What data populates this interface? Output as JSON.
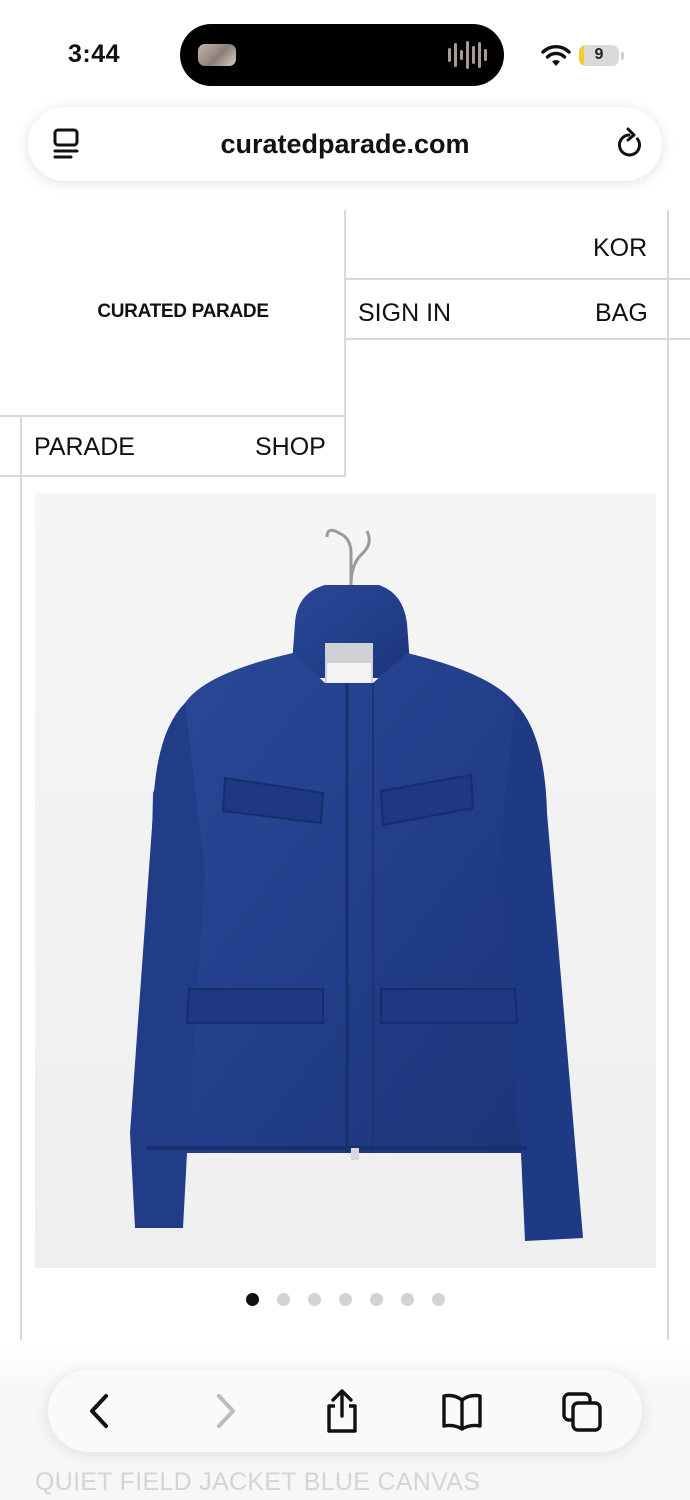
{
  "status_bar": {
    "time": "3:44",
    "battery_level": "9",
    "battery_fraction": 0.12
  },
  "browser": {
    "url": "curatedparade.com"
  },
  "site": {
    "brand": "CURATED PARADE",
    "nav": {
      "language": "KOR",
      "sign_in": "SIGN IN",
      "bag": "BAG",
      "parade": "PARADE",
      "shop": "SHOP"
    }
  },
  "product": {
    "name": "QUIET FIELD JACKET BLUE CANVAS",
    "image_count": 7,
    "active_image": 1,
    "jacket_color": "#233f8c"
  },
  "toolbar": {
    "icons": [
      "back-icon",
      "forward-icon",
      "share-icon",
      "bookmarks-icon",
      "tabs-icon"
    ]
  }
}
